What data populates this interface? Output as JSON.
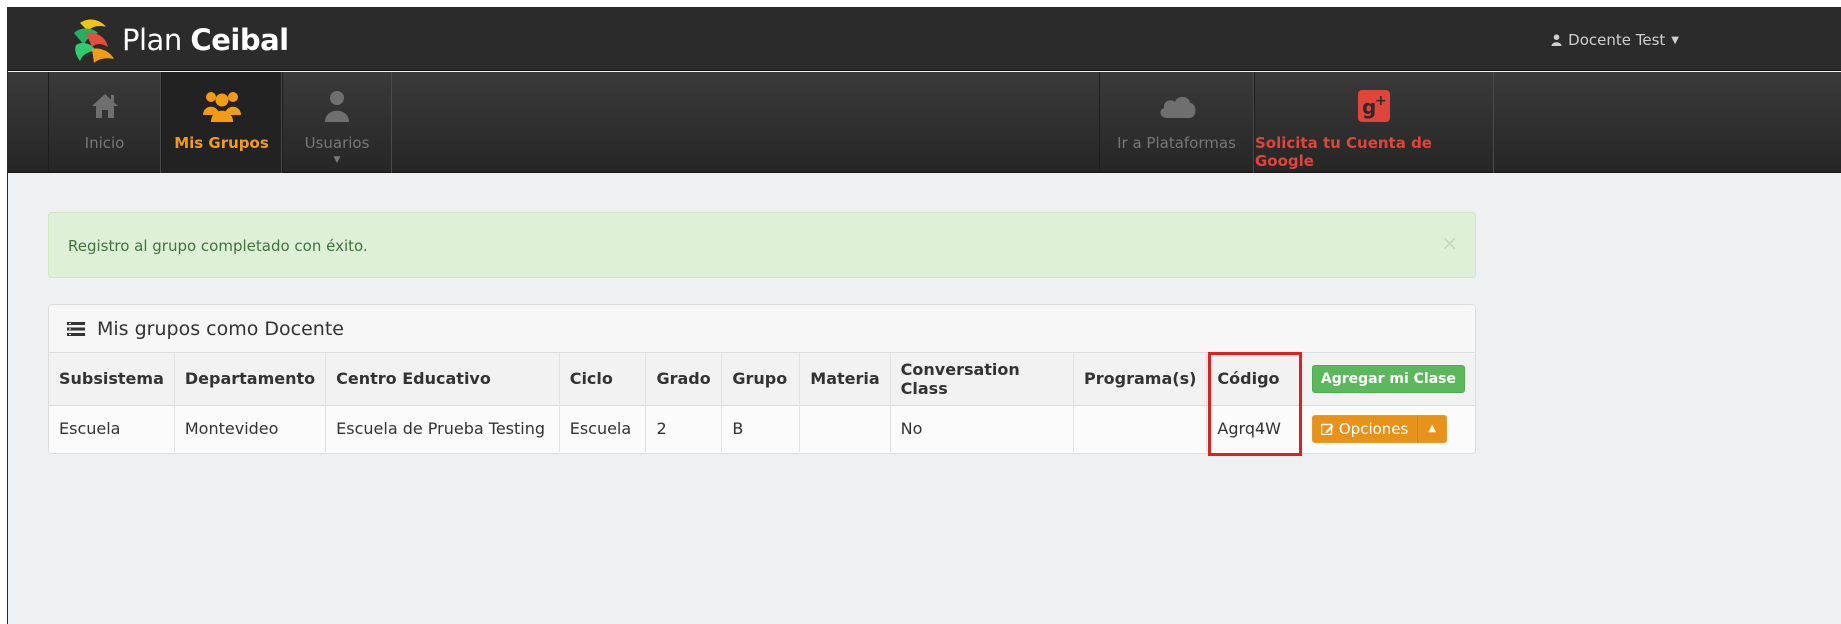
{
  "header": {
    "brand_light": "Plan",
    "brand_bold": "Ceibal",
    "user_name": "Docente Test"
  },
  "nav": {
    "items": [
      {
        "label": "Inicio",
        "icon": "home-icon"
      },
      {
        "label": "Mis Grupos",
        "icon": "users-group-icon"
      },
      {
        "label": "Usuarios",
        "icon": "user-icon"
      },
      {
        "label": "Ir a Plataformas",
        "icon": "cloud-icon"
      },
      {
        "label": "Solicita tu Cuenta de Google",
        "icon": "google-plus-icon"
      }
    ]
  },
  "alert": {
    "message": "Registro al grupo completado con éxito.",
    "close": "×"
  },
  "panel": {
    "title": "Mis grupos como Docente"
  },
  "table": {
    "headers": [
      "Subsistema",
      "Departamento",
      "Centro Educativo",
      "Ciclo",
      "Grado",
      "Grupo",
      "Materia",
      "Conversation Class",
      "Programa(s)",
      "Código"
    ],
    "add_button": "Agregar mi Clase",
    "rows": [
      {
        "cells": [
          "Escuela",
          "Montevideo",
          "Escuela de Prueba Testing",
          "Escuela",
          "2",
          "B",
          "",
          "No",
          "",
          "Agrq4W"
        ],
        "options_label": "Opciones"
      }
    ]
  },
  "colors": {
    "accent_orange": "#f39c12",
    "google_red": "#e0443a",
    "success_bg": "#dff0d8",
    "highlight_red": "#e02020"
  }
}
